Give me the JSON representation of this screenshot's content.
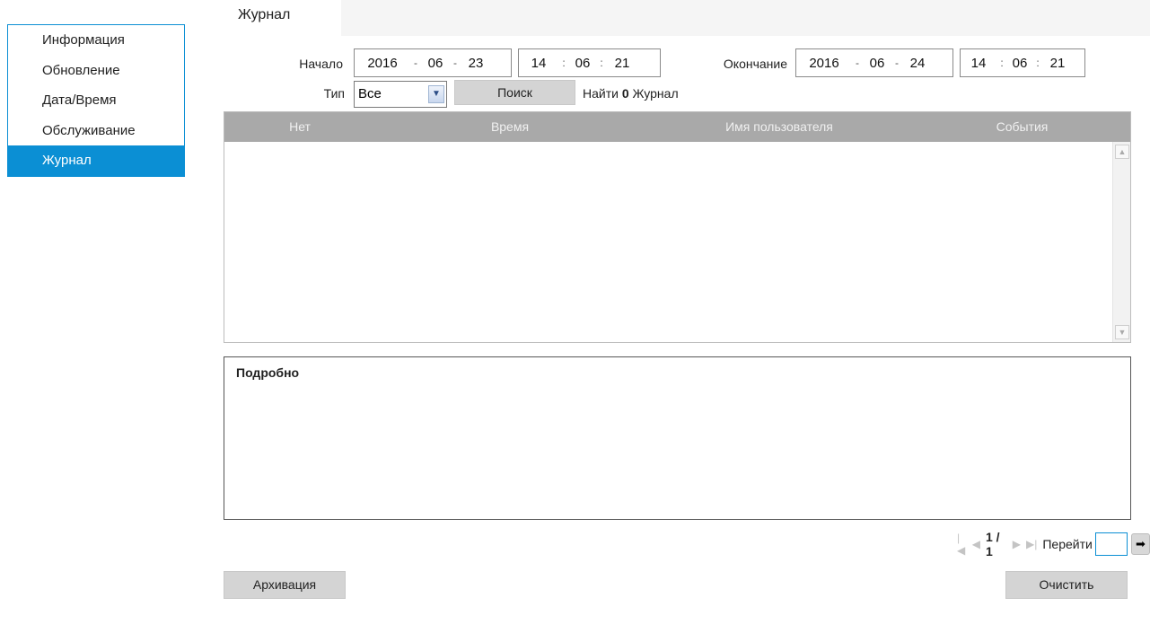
{
  "sidebar": {
    "items": [
      {
        "label": "Информация"
      },
      {
        "label": "Обновление"
      },
      {
        "label": "Дата/Время"
      },
      {
        "label": "Обслуживание"
      },
      {
        "label": "Журнал"
      }
    ],
    "active_index": 4
  },
  "tab": {
    "label": "Журнал"
  },
  "filters": {
    "start_label": "Начало",
    "start_date": {
      "year": "2016",
      "month": "06",
      "day": "23"
    },
    "start_time": {
      "h": "14",
      "m": "06",
      "s": "21"
    },
    "end_label": "Окончание",
    "end_date": {
      "year": "2016",
      "month": "06",
      "day": "24"
    },
    "end_time": {
      "h": "14",
      "m": "06",
      "s": "21"
    },
    "date_sep": "-",
    "time_sep": ":",
    "type_label": "Тип",
    "type_value": "Все",
    "search_label": "Поиск",
    "found_prefix": "Найти",
    "found_count": "0",
    "found_suffix": "Журнал"
  },
  "table": {
    "columns": [
      "Нет",
      "Время",
      "Имя пользователя",
      "События"
    ],
    "rows": []
  },
  "details": {
    "title": "Подробно"
  },
  "pager": {
    "page_text": "1 / 1",
    "goto_label": "Перейти",
    "goto_value": ""
  },
  "actions": {
    "backup_label": "Архивация",
    "clear_label": "Очистить"
  },
  "colors": {
    "accent": "#0b8fd4",
    "header_bg": "#a9a9a9",
    "button_bg": "#d4d4d4"
  }
}
